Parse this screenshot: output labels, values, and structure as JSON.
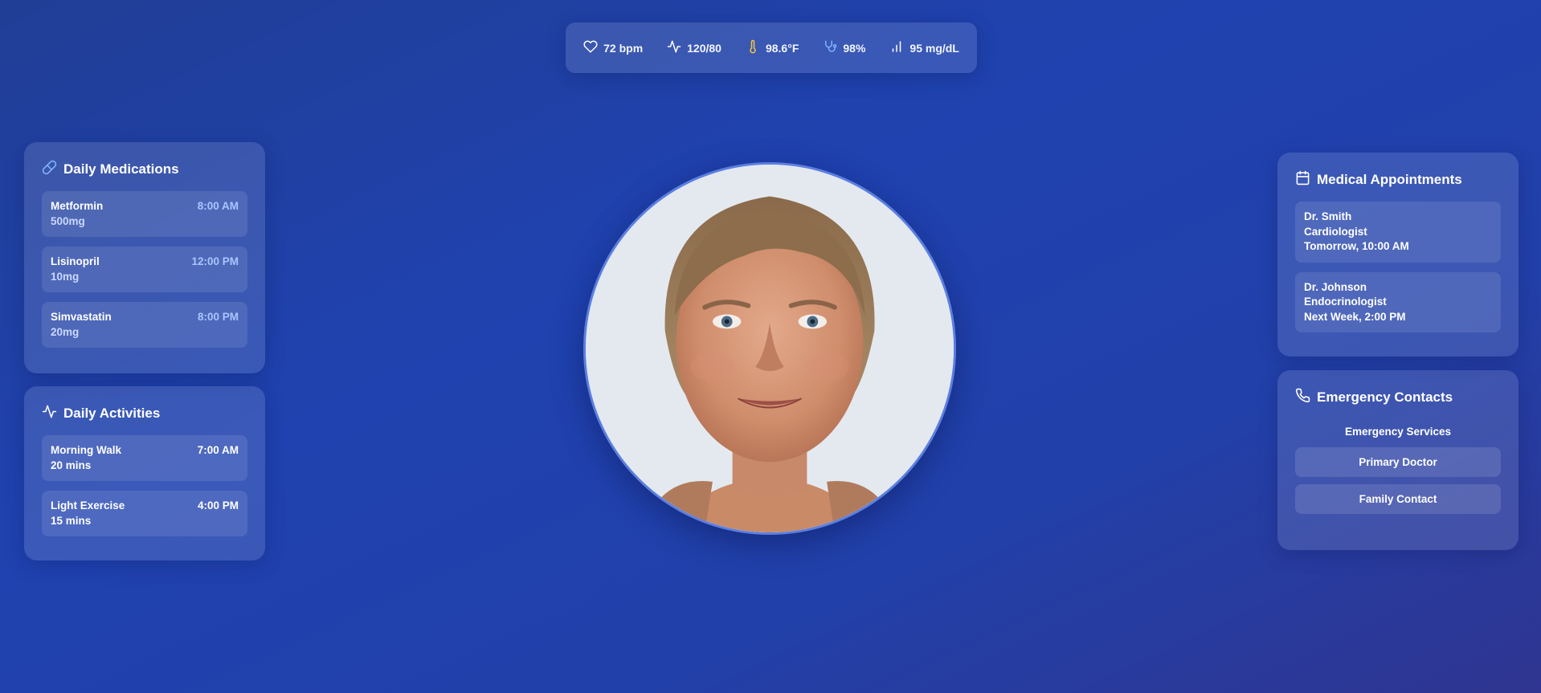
{
  "vitals": [
    {
      "icon": "heart-icon",
      "value": "72 bpm"
    },
    {
      "icon": "pulse-icon",
      "value": "120/80"
    },
    {
      "icon": "thermometer-icon",
      "value": "98.6°F"
    },
    {
      "icon": "stethoscope-icon",
      "value": "98%"
    },
    {
      "icon": "bar-chart-icon",
      "value": "95 mg/dL"
    }
  ],
  "medications": {
    "title": "Daily Medications",
    "icon": "pill-icon",
    "items": [
      {
        "name": "Metformin",
        "dose": "500mg",
        "time": "8:00 AM"
      },
      {
        "name": "Lisinopril",
        "dose": "10mg",
        "time": "12:00 PM"
      },
      {
        "name": "Simvastatin",
        "dose": "20mg",
        "time": "8:00 PM"
      }
    ]
  },
  "activities": {
    "title": "Daily Activities",
    "icon": "activity-icon",
    "items": [
      {
        "name": "Morning Walk",
        "duration": "20 mins",
        "time": "7:00 AM"
      },
      {
        "name": "Light Exercise",
        "duration": "15 mins",
        "time": "4:00 PM"
      }
    ]
  },
  "appointments": {
    "title": "Medical Appointments",
    "icon": "calendar-icon",
    "items": [
      {
        "doctor": "Dr. Smith",
        "specialty": "Cardiologist",
        "when": "Tomorrow, 10:00 AM"
      },
      {
        "doctor": "Dr. Johnson",
        "specialty": "Endocrinologist",
        "when": "Next Week, 2:00 PM"
      }
    ]
  },
  "contacts": {
    "title": "Emergency Contacts",
    "icon": "phone-icon",
    "items": [
      "Emergency Services",
      "Primary Doctor",
      "Family Contact"
    ]
  },
  "colors": {
    "background_start": "#213e96",
    "background_end": "#2f3591",
    "accent_blue": "#a9c6ff",
    "thermometer": "#f5c542",
    "stethoscope": "#7fb3ff"
  }
}
